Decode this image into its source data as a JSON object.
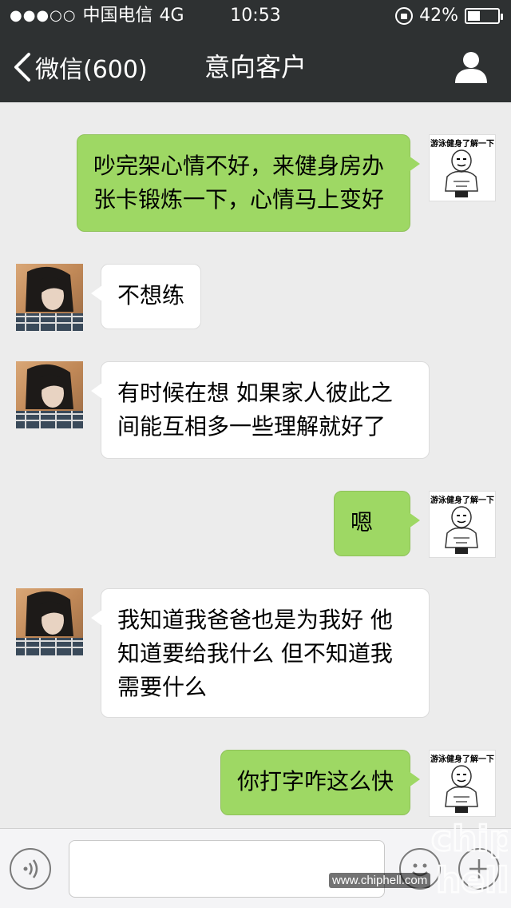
{
  "status_bar": {
    "signal_dots": "●●●○○",
    "carrier": "中国电信",
    "network": "4G",
    "time": "10:53",
    "battery_text": "42%",
    "battery_level": 0.42
  },
  "nav": {
    "back_label": "微信(600)",
    "title": "意向客户"
  },
  "avatar_caption": "游泳健身了解一下",
  "messages": [
    {
      "side": "me",
      "text": "吵完架心情不好，来健身房办张卡锻炼一下，心情马上变好"
    },
    {
      "side": "them",
      "text": "不想练"
    },
    {
      "side": "them",
      "text": "有时候在想 如果家人彼此之间能互相多一些理解就好了"
    },
    {
      "side": "me",
      "text": "嗯"
    },
    {
      "side": "them",
      "text": "我知道我爸爸也是为我好 他知道要给我什么 但不知道我需要什么"
    },
    {
      "side": "me",
      "text": "你打字咋这么快"
    }
  ],
  "input": {
    "value": "",
    "placeholder": ""
  },
  "watermark": {
    "url": "www.chiphell.com"
  },
  "colors": {
    "header_bg": "#2e3132",
    "chat_bg": "#ececec",
    "bubble_me": "#9ed864",
    "bubble_them": "#ffffff"
  }
}
